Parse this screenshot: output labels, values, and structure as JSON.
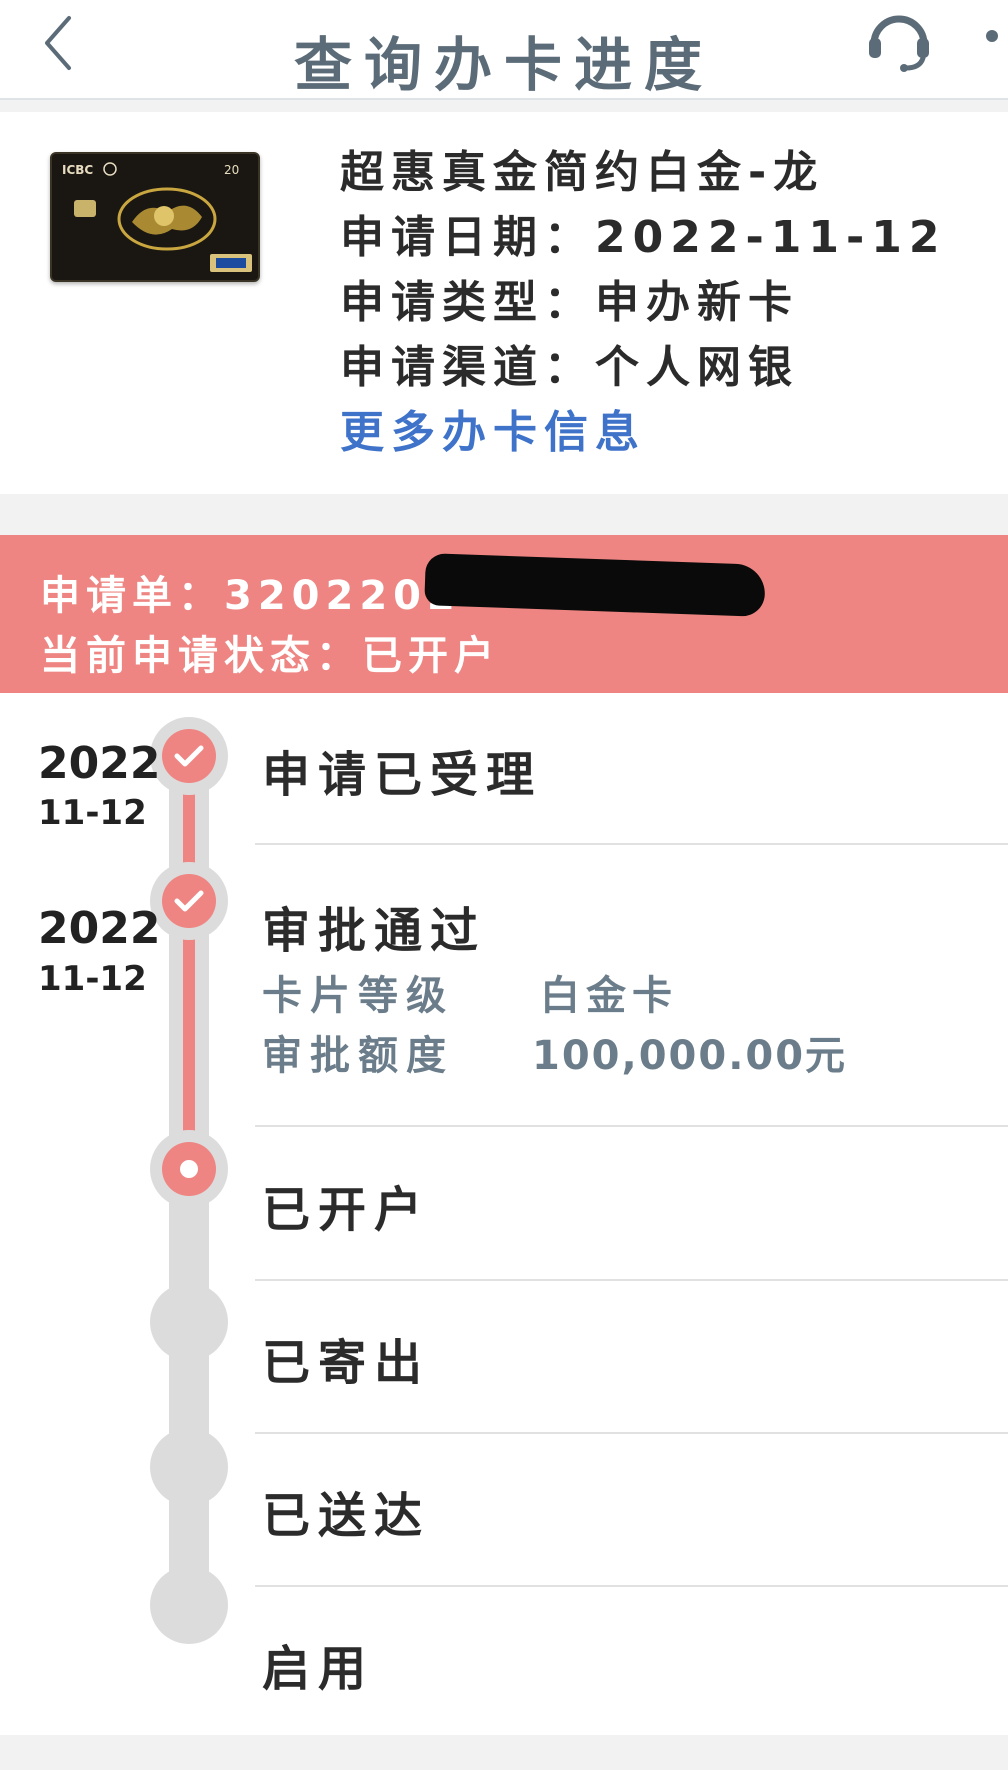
{
  "header": {
    "title": "查询办卡进度",
    "back_icon": "chevron-left-icon",
    "service_icon": "headset-icon"
  },
  "card": {
    "name": "超惠真金简约白金-龙",
    "apply_date_label": "申请日期：",
    "apply_date": "2022-11-12",
    "apply_type_label": "申请类型：",
    "apply_type": "申办新卡",
    "apply_channel_label": "申请渠道：",
    "apply_channel": "个人网银",
    "more_info_link": "更多办卡信息",
    "card_image_text": {
      "brand": "ICBC",
      "number": "20"
    }
  },
  "banner": {
    "order_label": "申请单：",
    "order_number_visible": "3202202",
    "status_label": "当前申请状态：",
    "status_value": "已开户",
    "color": "#ee8582"
  },
  "timeline": {
    "steps": [
      {
        "year": "2022",
        "day": "11-12",
        "label": "申请已受理",
        "state": "done"
      },
      {
        "year": "2022",
        "day": "11-12",
        "label": "审批通过",
        "state": "done",
        "details": [
          {
            "label": "卡片等级",
            "value": "白金卡"
          },
          {
            "label": "审批额度",
            "value": "100,000.00元"
          }
        ]
      },
      {
        "label": "已开户",
        "state": "current"
      },
      {
        "label": "已寄出",
        "state": "pending"
      },
      {
        "label": "已送达",
        "state": "pending"
      },
      {
        "label": "启用",
        "state": "pending"
      }
    ]
  },
  "colors": {
    "accent": "#ee8582",
    "link": "#3f73c9",
    "header_text": "#5b6c78",
    "detail_text": "#6b7d8a"
  }
}
